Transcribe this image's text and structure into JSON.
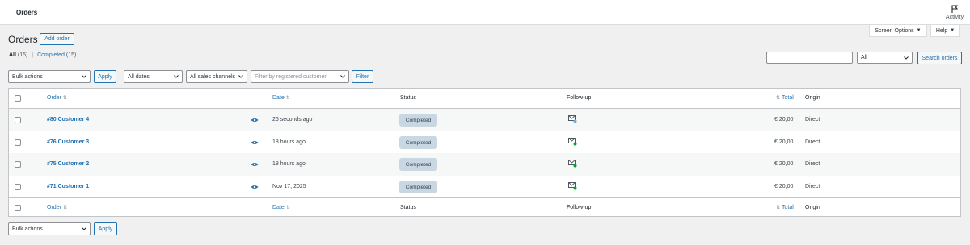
{
  "topbar": {
    "title": "Orders",
    "activity_label": "Activity"
  },
  "screen_options": {
    "screen_options_label": "Screen Options",
    "help_label": "Help"
  },
  "page": {
    "heading": "Orders",
    "add_order_label": "Add order"
  },
  "views": {
    "all_label": "All",
    "all_count": "(15)",
    "completed_label": "Completed",
    "completed_count": "(15)"
  },
  "search": {
    "status_selected": "All",
    "search_button_label": "Search orders",
    "value": ""
  },
  "filters": {
    "bulk_actions": "Bulk actions",
    "apply_label": "Apply",
    "dates": "All dates",
    "sales_channels": "All sales channels",
    "customer_placeholder": "Filter by registered customer",
    "filter_label": "Filter"
  },
  "columns": {
    "order": "Order",
    "date": "Date",
    "status": "Status",
    "followup": "Follow-up",
    "total": "Total",
    "origin": "Origin"
  },
  "orders": [
    {
      "order": "#80 Customer 4",
      "date": "26 seconds ago",
      "status": "Completed",
      "total": "€ 20,00",
      "origin": "Direct"
    },
    {
      "order": "#76 Customer 3",
      "date": "18 hours ago",
      "status": "Completed",
      "total": "€ 20,00",
      "origin": "Direct"
    },
    {
      "order": "#75 Customer 2",
      "date": "18 hours ago",
      "status": "Completed",
      "total": "€ 20,00",
      "origin": "Direct"
    },
    {
      "order": "#71 Customer 1",
      "date": "Nov 17, 2025",
      "status": "Completed",
      "total": "€ 20,00",
      "origin": "Direct"
    }
  ],
  "bottom": {
    "bulk_actions": "Bulk actions",
    "apply_label": "Apply"
  },
  "icons": {
    "followup_icon": "mail-check-icon",
    "preview_icon": "eye-icon",
    "activity_icon": "flag-icon"
  },
  "colors": {
    "link": "#2271b1",
    "status_completed_bg": "#c8d7e1",
    "status_completed_text": "#2e4453",
    "followup_dot": "#00a32a"
  }
}
